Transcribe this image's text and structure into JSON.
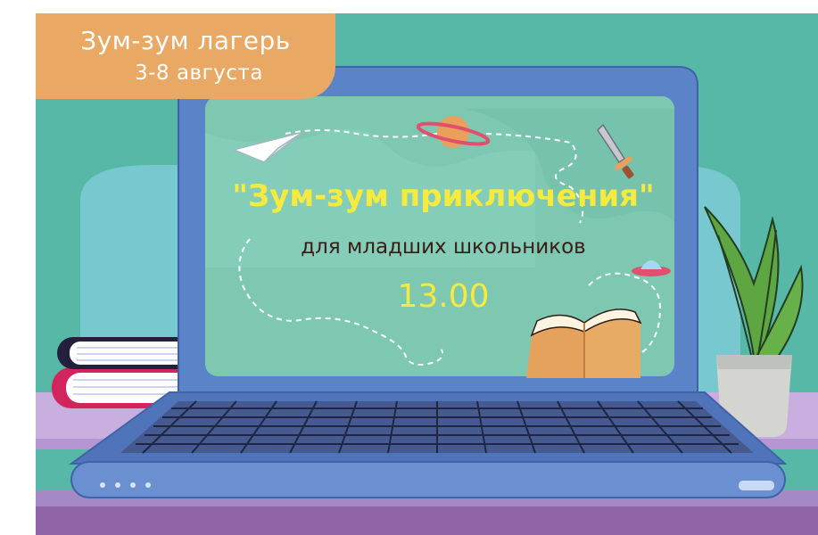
{
  "badge": {
    "title": "Зум-зум лагерь",
    "dates": "3-8 августа"
  },
  "screen": {
    "headline": "\"Зум-зум приключения\"",
    "subheadline": "для младших школьников",
    "time": "13.00"
  },
  "colors": {
    "background_teal": "#58b8a8",
    "badge_orange": "#e9a864",
    "laptop_blue": "#5b84c8",
    "screen_mint": "#7ec8b2",
    "headline_yellow": "#f6ea3f",
    "subheadline_dark": "#3a1d16",
    "shelf_purple": "#8f64a7",
    "shelf_lilac": "#c9aee0"
  },
  "icons": [
    "paper-plane-icon",
    "planet-icon",
    "sword-icon",
    "ufo-icon",
    "open-book-icon",
    "potted-plant-icon",
    "books-stack-icon",
    "laptop-icon"
  ]
}
